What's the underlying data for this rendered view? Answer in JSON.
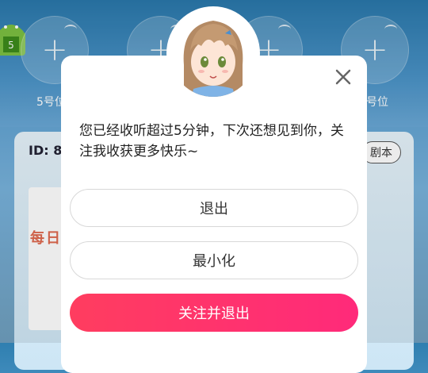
{
  "seats": [
    {
      "label": "5号位",
      "plus": "+"
    },
    {
      "label": "",
      "plus": "+"
    },
    {
      "label": "",
      "plus": "+"
    },
    {
      "label": "号位",
      "plus": "+"
    }
  ],
  "room": {
    "id_label": "ID: 8",
    "script_button": "剧本",
    "poster_text": "每日"
  },
  "dialog": {
    "message": "您已经收听超过5分钟，下次还想见到你，关注我收获更多快乐~",
    "exit_button": "退出",
    "minimize_button": "最小化",
    "follow_exit_button": "关注并退出"
  },
  "colors": {
    "primary_gradient_start": "#ff3d5f",
    "primary_gradient_end": "#ff2a7a"
  }
}
